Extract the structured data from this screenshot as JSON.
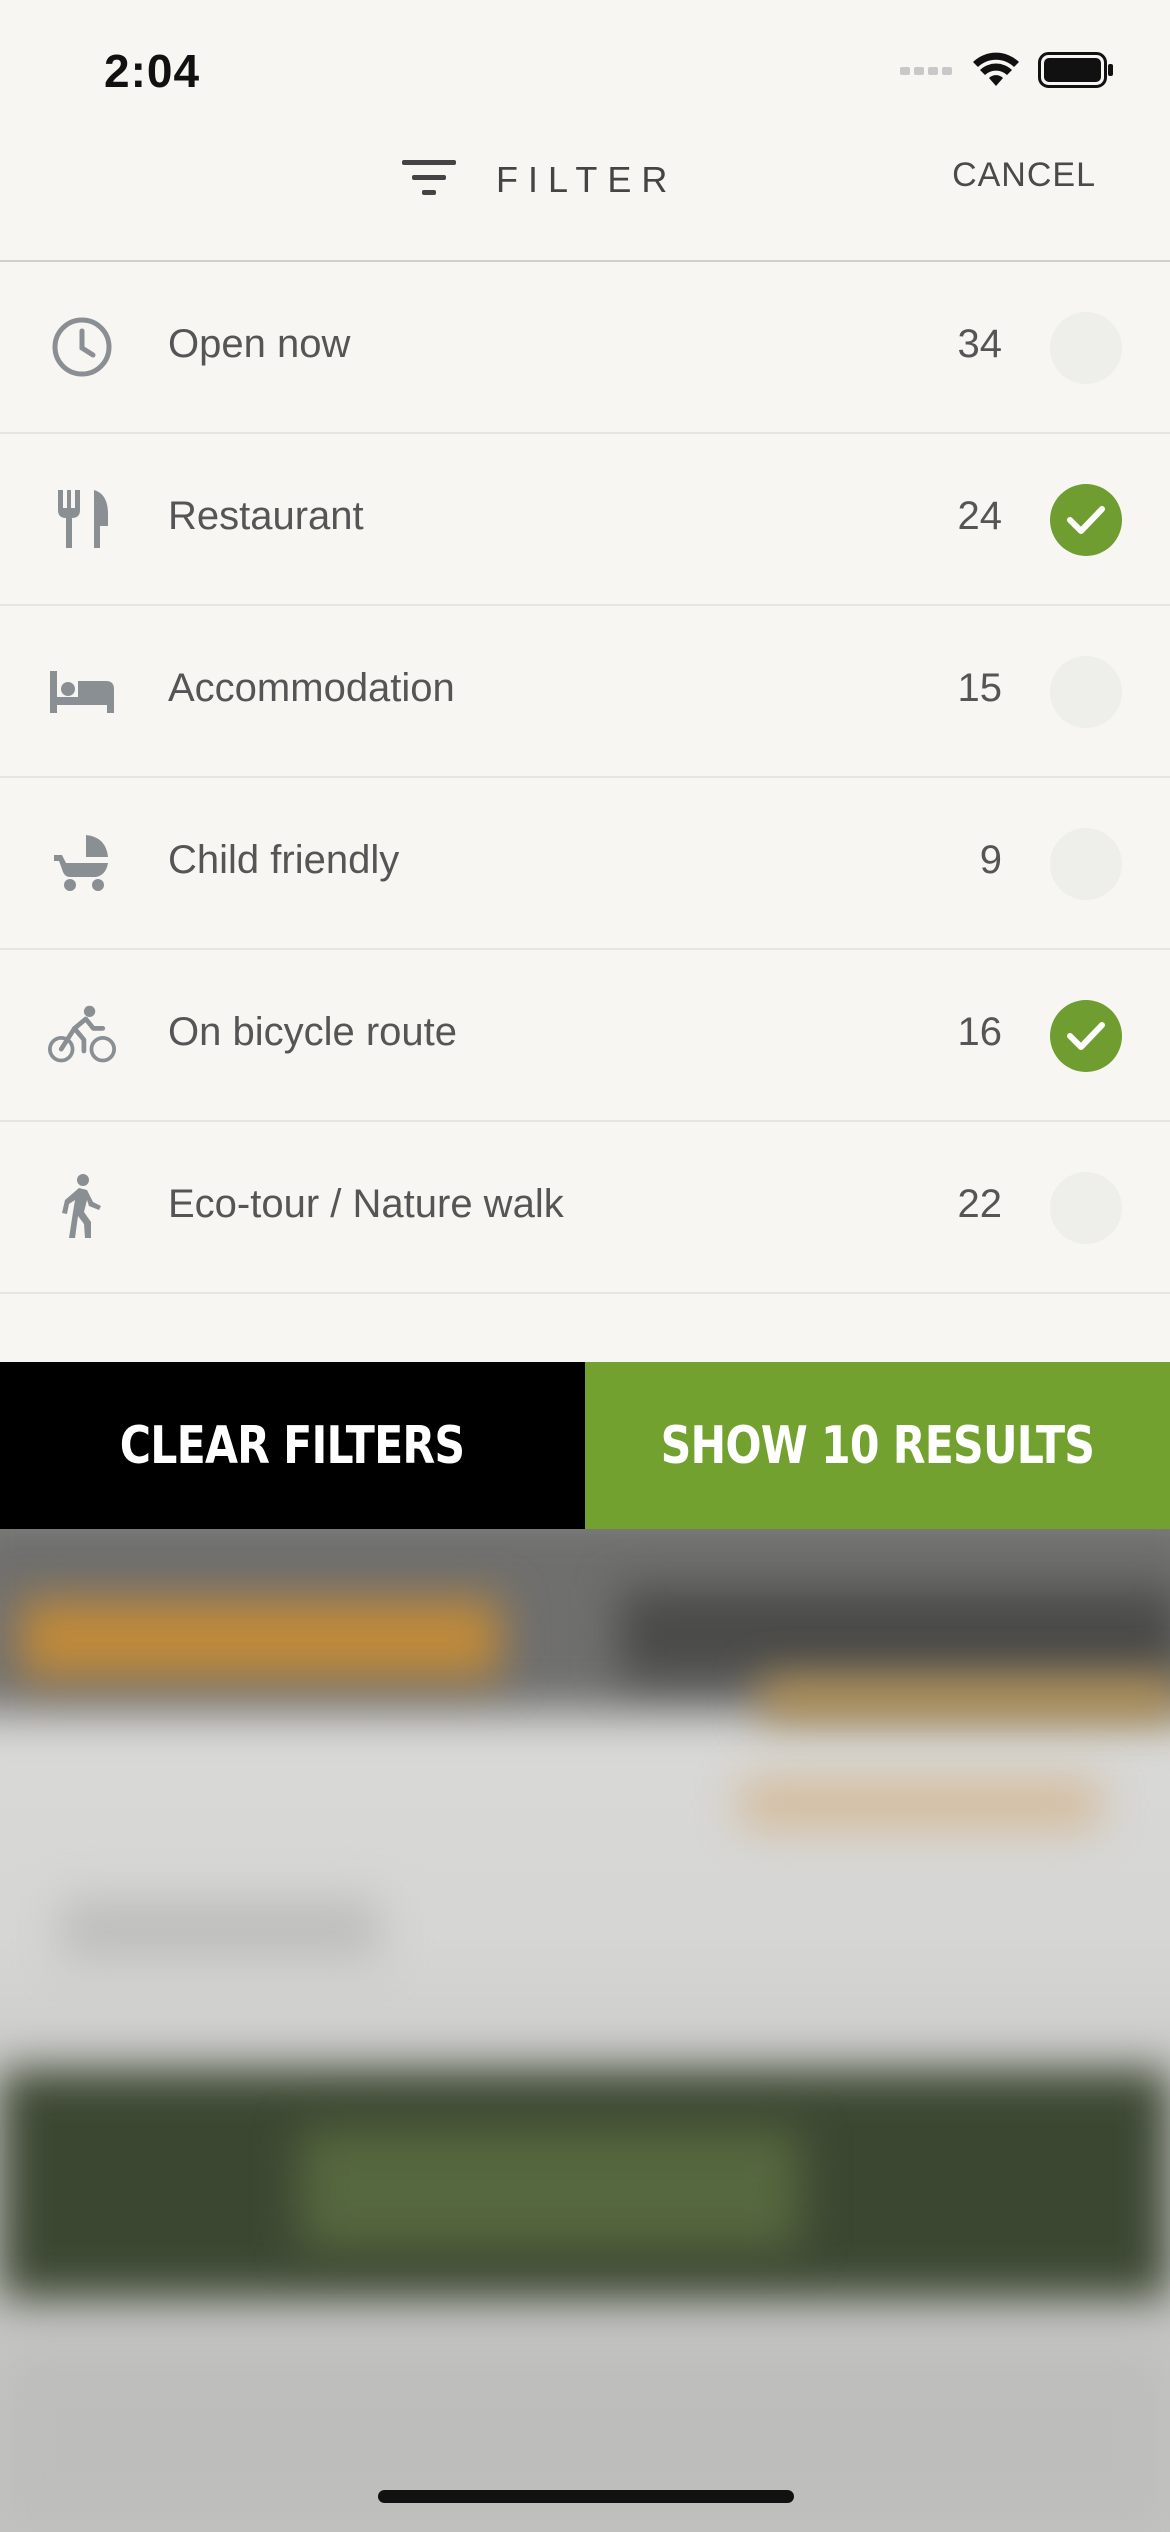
{
  "status_bar": {
    "time": "2:04"
  },
  "header": {
    "title": "FILTER",
    "cancel_label": "CANCEL"
  },
  "filters": [
    {
      "icon": "clock-icon",
      "label": "Open now",
      "count": "34",
      "checked": false
    },
    {
      "icon": "fork-knife-icon",
      "label": "Restaurant",
      "count": "24",
      "checked": true
    },
    {
      "icon": "bed-icon",
      "label": "Accommodation",
      "count": "15",
      "checked": false
    },
    {
      "icon": "stroller-icon",
      "label": "Child friendly",
      "count": "9",
      "checked": false
    },
    {
      "icon": "bicycle-icon",
      "label": "On bicycle route",
      "count": "16",
      "checked": true
    },
    {
      "icon": "walking-person-icon",
      "label": "Eco-tour / Nature walk",
      "count": "22",
      "checked": false
    }
  ],
  "actions": {
    "clear_label": "CLEAR FILTERS",
    "show_label": "SHOW 10 RESULTS"
  },
  "colors": {
    "accent_green": "#72a12f",
    "check_green": "#6f9d2f",
    "background": "#f7f6f2",
    "black": "#000000"
  }
}
